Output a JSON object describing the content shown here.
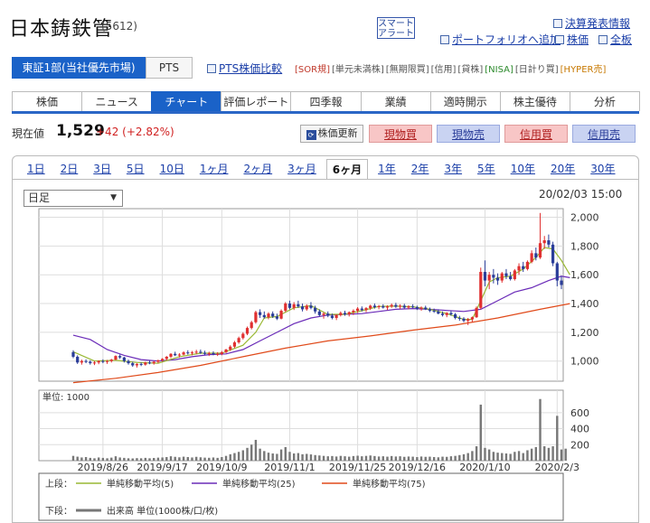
{
  "header": {
    "company": "日本鋳鉄管",
    "code": "(5612)",
    "smart_alert_1": "スマート",
    "smart_alert_2": "アラート",
    "links": {
      "earnings": "決算発表情報",
      "portfolio": "ポートフォリオへ追加",
      "board": "株価",
      "all": "全板"
    }
  },
  "market": {
    "label": "東証1部(当社優先市場)",
    "pts": "PTS",
    "pts_compare": "PTS株価比較",
    "tags": [
      "[SOR規]",
      "[単元未満株]",
      "[無期限買]",
      "[信用]",
      "[貸株]",
      "[NISA]",
      "[日計り買]",
      "[HYPER売]"
    ],
    "tag_colors": [
      "#c0392b",
      "#555555",
      "#555555",
      "#555555",
      "#555555",
      "#2e8b2e",
      "#555555",
      "#c77800"
    ]
  },
  "tabs": [
    "株価",
    "ニュース",
    "チャート",
    "評価レポート",
    "四季報",
    "業績",
    "適時開示",
    "株主優待",
    "分析"
  ],
  "active_tab": 2,
  "price": {
    "label": "現在値",
    "value": "1,529",
    "change": "+42 (+2.82%)",
    "refresh": "株価更新",
    "buttons": [
      "現物買",
      "現物売",
      "信用買",
      "信用売"
    ]
  },
  "periods": [
    "1日",
    "2日",
    "3日",
    "5日",
    "10日",
    "1ヶ月",
    "2ヶ月",
    "3ヶ月",
    "6ヶ月",
    "1年",
    "2年",
    "3年",
    "5年",
    "10年",
    "20年",
    "30年"
  ],
  "active_period": 8,
  "chart_controls": {
    "interval": "日足",
    "timestamp": "20/02/03 15:00"
  },
  "chart_data": {
    "type": "candlestick",
    "price_axis": {
      "ylim": [
        860,
        2060
      ],
      "ticks": [
        "1,000",
        "1,200",
        "1,400",
        "1,600",
        "1,800",
        "2,000"
      ]
    },
    "volume_axis": {
      "unit_label": "単位: 1000",
      "ylim": [
        0,
        880
      ],
      "ticks": [
        "200",
        "400",
        "600"
      ]
    },
    "x_ticks": [
      "2019/8/26",
      "2019/9/17",
      "2019/10/9",
      "2019/11/1",
      "2019/11/25",
      "2019/12/16",
      "2020/1/10",
      "2020/2/3"
    ],
    "x_tick_index": [
      7,
      21,
      35,
      51,
      67,
      81,
      97,
      114
    ],
    "colors": {
      "up": "#e03030",
      "down": "#2a3d99",
      "ma5": "#99b833",
      "ma25": "#6a2bb8",
      "ma75": "#e04a1a",
      "volume": "#777777"
    },
    "candles": [
      [
        1062,
        1075,
        1020,
        1030
      ],
      [
        1030,
        1040,
        980,
        990
      ],
      [
        990,
        1010,
        975,
        1000
      ],
      [
        1000,
        1012,
        985,
        995
      ],
      [
        995,
        1005,
        975,
        985
      ],
      [
        985,
        1000,
        972,
        990
      ],
      [
        990,
        1005,
        978,
        1000
      ],
      [
        1000,
        1012,
        985,
        995
      ],
      [
        995,
        1008,
        980,
        1000
      ],
      [
        1000,
        1015,
        990,
        1010
      ],
      [
        1010,
        1040,
        1005,
        1035
      ],
      [
        1035,
        1045,
        1015,
        1025
      ],
      [
        1025,
        1030,
        990,
        1000
      ],
      [
        1000,
        1010,
        975,
        985
      ],
      [
        985,
        995,
        960,
        970
      ],
      [
        970,
        985,
        955,
        980
      ],
      [
        980,
        990,
        965,
        975
      ],
      [
        975,
        995,
        968,
        990
      ],
      [
        990,
        1002,
        978,
        985
      ],
      [
        985,
        1000,
        975,
        995
      ],
      [
        995,
        1010,
        985,
        1005
      ],
      [
        1005,
        1020,
        995,
        1015
      ],
      [
        1015,
        1035,
        1005,
        1030
      ],
      [
        1030,
        1055,
        1020,
        1050
      ],
      [
        1050,
        1065,
        1035,
        1040
      ],
      [
        1040,
        1055,
        1025,
        1045
      ],
      [
        1045,
        1068,
        1040,
        1060
      ],
      [
        1060,
        1075,
        1045,
        1055
      ],
      [
        1055,
        1070,
        1040,
        1060
      ],
      [
        1060,
        1078,
        1048,
        1065
      ],
      [
        1065,
        1080,
        1050,
        1058
      ],
      [
        1058,
        1072,
        1042,
        1050
      ],
      [
        1050,
        1065,
        1035,
        1055
      ],
      [
        1055,
        1068,
        1040,
        1048
      ],
      [
        1048,
        1062,
        1035,
        1050
      ],
      [
        1050,
        1070,
        1040,
        1062
      ],
      [
        1062,
        1085,
        1055,
        1080
      ],
      [
        1080,
        1110,
        1070,
        1100
      ],
      [
        1100,
        1140,
        1090,
        1130
      ],
      [
        1130,
        1170,
        1120,
        1160
      ],
      [
        1160,
        1200,
        1150,
        1190
      ],
      [
        1190,
        1240,
        1180,
        1230
      ],
      [
        1230,
        1280,
        1220,
        1270
      ],
      [
        1270,
        1350,
        1260,
        1340
      ],
      [
        1340,
        1360,
        1300,
        1320
      ],
      [
        1320,
        1345,
        1295,
        1305
      ],
      [
        1305,
        1340,
        1290,
        1330
      ],
      [
        1330,
        1345,
        1300,
        1310
      ],
      [
        1310,
        1330,
        1285,
        1295
      ],
      [
        1295,
        1360,
        1290,
        1350
      ],
      [
        1350,
        1410,
        1340,
        1400
      ],
      [
        1400,
        1420,
        1360,
        1370
      ],
      [
        1370,
        1410,
        1355,
        1395
      ],
      [
        1395,
        1420,
        1370,
        1380
      ],
      [
        1380,
        1400,
        1345,
        1360
      ],
      [
        1360,
        1395,
        1350,
        1385
      ],
      [
        1385,
        1410,
        1360,
        1370
      ],
      [
        1370,
        1385,
        1330,
        1345
      ],
      [
        1345,
        1360,
        1310,
        1320
      ],
      [
        1320,
        1340,
        1295,
        1330
      ],
      [
        1330,
        1345,
        1305,
        1315
      ],
      [
        1315,
        1330,
        1290,
        1300
      ],
      [
        1300,
        1325,
        1285,
        1320
      ],
      [
        1320,
        1345,
        1310,
        1335
      ],
      [
        1335,
        1350,
        1315,
        1325
      ],
      [
        1325,
        1345,
        1310,
        1340
      ],
      [
        1340,
        1360,
        1320,
        1350
      ],
      [
        1350,
        1375,
        1335,
        1365
      ],
      [
        1365,
        1380,
        1345,
        1355
      ],
      [
        1355,
        1375,
        1340,
        1368
      ],
      [
        1368,
        1392,
        1355,
        1385
      ],
      [
        1385,
        1400,
        1365,
        1375
      ],
      [
        1375,
        1390,
        1360,
        1382
      ],
      [
        1382,
        1395,
        1365,
        1372
      ],
      [
        1372,
        1388,
        1355,
        1380
      ],
      [
        1380,
        1400,
        1370,
        1390
      ],
      [
        1390,
        1405,
        1370,
        1378
      ],
      [
        1378,
        1395,
        1362,
        1385
      ],
      [
        1385,
        1398,
        1365,
        1372
      ],
      [
        1372,
        1388,
        1360,
        1380
      ],
      [
        1380,
        1395,
        1368,
        1375
      ],
      [
        1375,
        1385,
        1355,
        1365
      ],
      [
        1365,
        1380,
        1350,
        1372
      ],
      [
        1372,
        1385,
        1355,
        1360
      ],
      [
        1360,
        1372,
        1340,
        1350
      ],
      [
        1350,
        1365,
        1335,
        1345
      ],
      [
        1345,
        1360,
        1325,
        1330
      ],
      [
        1330,
        1345,
        1310,
        1320
      ],
      [
        1320,
        1340,
        1305,
        1335
      ],
      [
        1335,
        1350,
        1315,
        1325
      ],
      [
        1325,
        1335,
        1290,
        1300
      ],
      [
        1300,
        1315,
        1280,
        1295
      ],
      [
        1295,
        1305,
        1270,
        1280
      ],
      [
        1280,
        1300,
        1250,
        1290
      ],
      [
        1290,
        1310,
        1270,
        1305
      ],
      [
        1305,
        1380,
        1300,
        1370
      ],
      [
        1370,
        1650,
        1360,
        1620
      ],
      [
        1620,
        1700,
        1520,
        1560
      ],
      [
        1560,
        1620,
        1500,
        1600
      ],
      [
        1600,
        1640,
        1540,
        1580
      ],
      [
        1580,
        1610,
        1530,
        1560
      ],
      [
        1560,
        1620,
        1545,
        1610
      ],
      [
        1610,
        1640,
        1570,
        1590
      ],
      [
        1590,
        1620,
        1560,
        1570
      ],
      [
        1570,
        1640,
        1560,
        1630
      ],
      [
        1630,
        1680,
        1600,
        1660
      ],
      [
        1660,
        1690,
        1620,
        1640
      ],
      [
        1640,
        1700,
        1630,
        1690
      ],
      [
        1690,
        1770,
        1680,
        1750
      ],
      [
        1750,
        1790,
        1700,
        1720
      ],
      [
        1720,
        2030,
        1710,
        1820
      ],
      [
        1820,
        1870,
        1780,
        1840
      ],
      [
        1840,
        1880,
        1790,
        1810
      ],
      [
        1810,
        1830,
        1660,
        1680
      ],
      [
        1680,
        1690,
        1520,
        1560
      ],
      [
        1560,
        1590,
        1500,
        1529
      ]
    ],
    "ma5": [
      [
        0,
        1065
      ],
      [
        5,
        1000
      ],
      [
        10,
        1005
      ],
      [
        15,
        990
      ],
      [
        20,
        985
      ],
      [
        25,
        1030
      ],
      [
        30,
        1055
      ],
      [
        35,
        1055
      ],
      [
        40,
        1110
      ],
      [
        43,
        1200
      ],
      [
        45,
        1300
      ],
      [
        48,
        1310
      ],
      [
        52,
        1370
      ],
      [
        56,
        1385
      ],
      [
        60,
        1325
      ],
      [
        64,
        1325
      ],
      [
        68,
        1350
      ],
      [
        72,
        1380
      ],
      [
        76,
        1382
      ],
      [
        80,
        1378
      ],
      [
        84,
        1360
      ],
      [
        88,
        1330
      ],
      [
        92,
        1290
      ],
      [
        94,
        1290
      ],
      [
        96,
        1420
      ],
      [
        98,
        1550
      ],
      [
        100,
        1580
      ],
      [
        103,
        1590
      ],
      [
        106,
        1640
      ],
      [
        109,
        1720
      ],
      [
        111,
        1790
      ],
      [
        113,
        1780
      ],
      [
        115,
        1700
      ],
      [
        117,
        1600
      ]
    ],
    "ma25": [
      [
        0,
        1180
      ],
      [
        4,
        1150
      ],
      [
        8,
        1080
      ],
      [
        12,
        1040
      ],
      [
        16,
        1010
      ],
      [
        20,
        1000
      ],
      [
        24,
        1010
      ],
      [
        28,
        1030
      ],
      [
        32,
        1045
      ],
      [
        36,
        1050
      ],
      [
        40,
        1080
      ],
      [
        44,
        1140
      ],
      [
        48,
        1200
      ],
      [
        52,
        1260
      ],
      [
        56,
        1300
      ],
      [
        60,
        1320
      ],
      [
        64,
        1325
      ],
      [
        68,
        1330
      ],
      [
        72,
        1345
      ],
      [
        76,
        1360
      ],
      [
        80,
        1365
      ],
      [
        84,
        1360
      ],
      [
        88,
        1352
      ],
      [
        92,
        1345
      ],
      [
        96,
        1360
      ],
      [
        100,
        1420
      ],
      [
        104,
        1480
      ],
      [
        108,
        1510
      ],
      [
        112,
        1560
      ],
      [
        115,
        1590
      ],
      [
        117,
        1580
      ]
    ],
    "ma75": [
      [
        0,
        850
      ],
      [
        10,
        880
      ],
      [
        20,
        920
      ],
      [
        30,
        970
      ],
      [
        40,
        1030
      ],
      [
        50,
        1090
      ],
      [
        60,
        1140
      ],
      [
        70,
        1175
      ],
      [
        80,
        1215
      ],
      [
        90,
        1250
      ],
      [
        100,
        1300
      ],
      [
        110,
        1360
      ],
      [
        117,
        1400
      ]
    ],
    "volume": [
      60,
      50,
      40,
      45,
      35,
      30,
      40,
      35,
      30,
      38,
      55,
      40,
      35,
      30,
      28,
      32,
      30,
      35,
      30,
      34,
      38,
      40,
      45,
      55,
      48,
      42,
      50,
      45,
      40,
      48,
      42,
      38,
      36,
      40,
      35,
      45,
      60,
      80,
      95,
      110,
      130,
      160,
      200,
      260,
      150,
      120,
      100,
      90,
      85,
      140,
      170,
      110,
      90,
      95,
      80,
      85,
      78,
      70,
      65,
      60,
      55,
      58,
      52,
      60,
      55,
      50,
      58,
      62,
      55,
      60,
      65,
      58,
      52,
      55,
      50,
      58,
      52,
      55,
      48,
      52,
      50,
      45,
      52,
      48,
      50,
      45,
      42,
      50,
      48,
      55,
      60,
      70,
      80,
      95,
      120,
      180,
      700,
      160,
      140,
      110,
      100,
      95,
      90,
      85,
      110,
      120,
      95,
      130,
      150,
      170,
      770,
      180,
      160,
      180,
      560,
      140,
      150
    ],
    "legend": {
      "upper_label": "上段：",
      "lower_label": "下段：",
      "items": [
        "単純移動平均(5)",
        "単純移動平均(25)",
        "単純移動平均(75)"
      ],
      "volume_item": "出来高 単位(1000株/口/枚)"
    }
  }
}
